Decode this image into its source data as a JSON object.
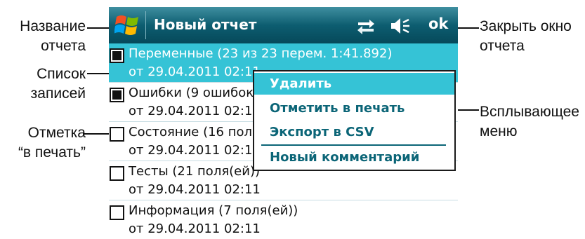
{
  "titlebar": {
    "title": "Новый отчет",
    "ok_label": "ok",
    "icons": [
      "windows-start-icon",
      "connectivity-arrows-icon",
      "speaker-volume-icon"
    ],
    "colors": {
      "top": "#3f8fa0",
      "bottom": "#06495a"
    }
  },
  "records": [
    {
      "title": "Переменные (23 из 23 перем. 1:41.892)",
      "date": "от 29.04.2011  02:11",
      "checked": true,
      "selected": true
    },
    {
      "title": "Ошибки (9 ошибок)",
      "date": "от 29.04.2011  02:11",
      "checked": true,
      "selected": false
    },
    {
      "title": "Состояние (16 поля(ей))",
      "date": "от 29.04.2011  02:11",
      "checked": false,
      "selected": false
    },
    {
      "title": "Тесты (21 поля(ей))",
      "date": "от 29.04.2011  02:11",
      "checked": false,
      "selected": false
    },
    {
      "title": "Информация (7 поля(ей))",
      "date": "от 29.04.2011  02:11",
      "checked": false,
      "selected": false
    }
  ],
  "popup_menu": {
    "items": [
      "Удалить",
      "Отметить в печать",
      "Экспорт в CSV",
      "Новый комментарий"
    ],
    "highlighted_index": 0,
    "highlight_color": "#35c3d6",
    "text_color": "#0b6577"
  },
  "callouts": {
    "report_name": [
      "Название",
      "отчета"
    ],
    "record_list": [
      "Список",
      "записей"
    ],
    "print_mark": [
      "Отметка",
      "“в печать”"
    ],
    "close_report": [
      "Закрыть окно",
      "отчета"
    ],
    "popup_menu": [
      "Всплывающее",
      "меню"
    ]
  }
}
